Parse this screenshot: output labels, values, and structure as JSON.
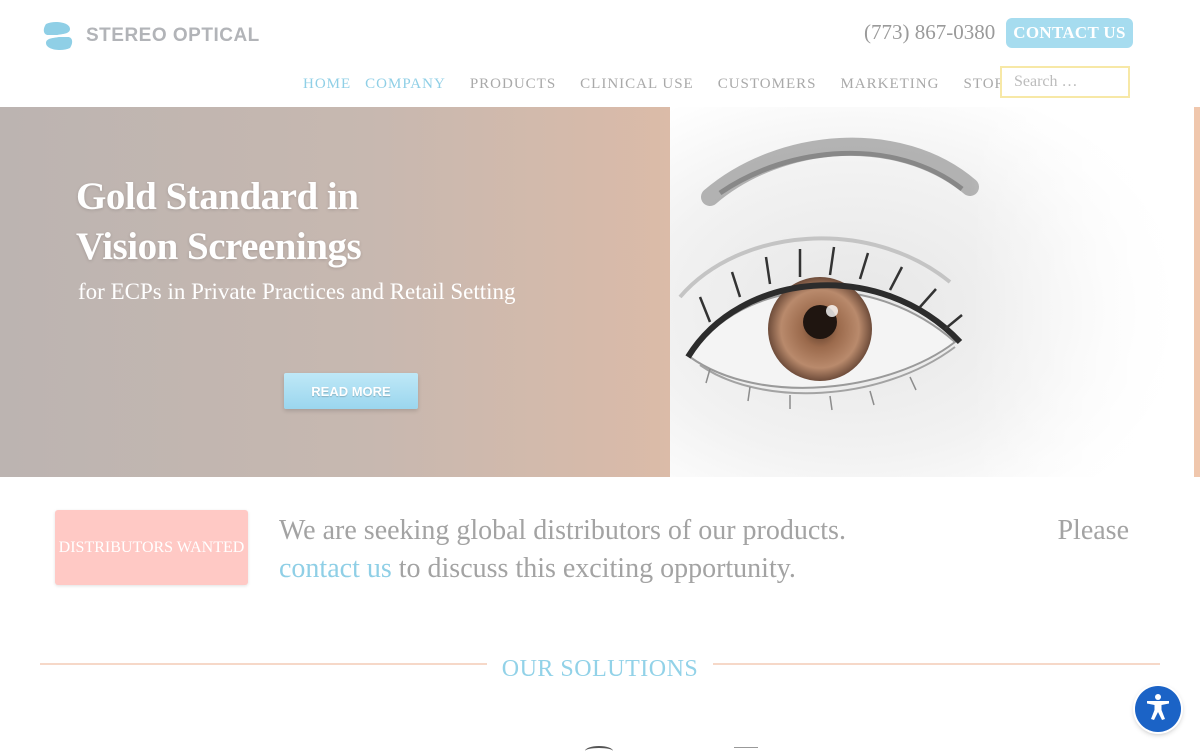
{
  "header": {
    "logo_text": "STEREO OPTICAL",
    "phone": "(773) 867-0380",
    "contact_label": "CONTACT US"
  },
  "nav": {
    "items": [
      "HOME",
      "COMPANY",
      "PRODUCTS",
      "CLINICAL USE",
      "CUSTOMERS",
      "MARKETING",
      "STORE"
    ],
    "search_placeholder": "Search …"
  },
  "hero": {
    "title_line1": "Gold Standard in",
    "title_line2": "Vision Screenings",
    "subtitle": "for ECPs in Private Practices and Retail Setting",
    "cta": "READ MORE"
  },
  "distributors": {
    "badge": "DISTRIBUTORS WANTED",
    "text_part1": "We are seeking global distributors of our products.",
    "text_right": "Please",
    "link": "contact us",
    "text_part2": "to discuss this exciting opportunity."
  },
  "solutions": {
    "title": "OUR SOLUTIONS"
  },
  "colors": {
    "accent_blue": "#8fcfe6",
    "contact_bg": "#a6dcef",
    "badge_pink": "#ffc9c5",
    "a11y_blue": "#1b63c6"
  },
  "icons": [
    "stereo-optical-logo-icon",
    "eye-image",
    "accessibility-icon"
  ]
}
